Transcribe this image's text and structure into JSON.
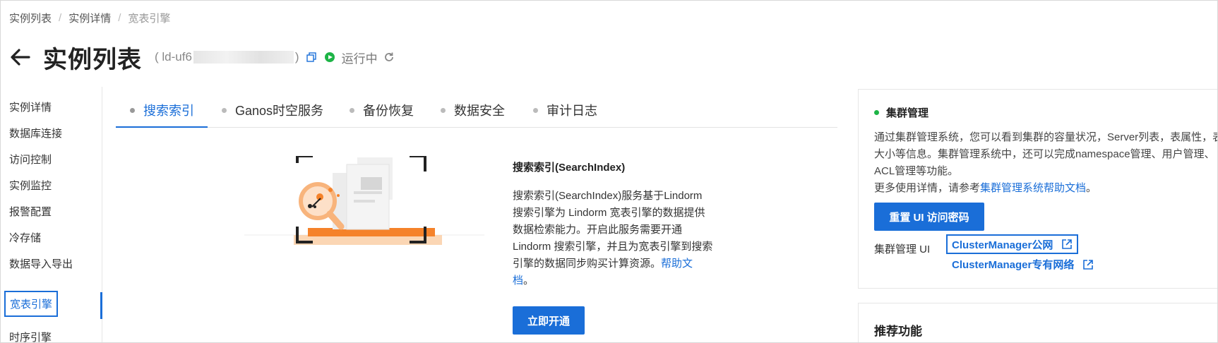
{
  "breadcrumb": {
    "items": [
      "实例列表",
      "实例详情",
      "宽表引擎"
    ],
    "separator": "/"
  },
  "header": {
    "title": "实例列表",
    "instance_id_prefix": "( ld-uf6",
    "instance_id_suffix": ")",
    "status": "运行中",
    "status_color": "#1db446"
  },
  "sidebar": {
    "items": [
      {
        "label": "实例详情"
      },
      {
        "label": "数据库连接"
      },
      {
        "label": "访问控制"
      },
      {
        "label": "实例监控"
      },
      {
        "label": "报警配置"
      },
      {
        "label": "冷存储"
      },
      {
        "label": "数据导入导出"
      },
      {
        "label": "宽表引擎"
      },
      {
        "label": "时序引擎"
      }
    ],
    "active_label": "宽表引擎"
  },
  "tabs": {
    "items": [
      {
        "label": "搜索索引"
      },
      {
        "label": "Ganos时空服务"
      },
      {
        "label": "备份恢复"
      },
      {
        "label": "数据安全"
      },
      {
        "label": "审计日志"
      }
    ],
    "active_label": "搜索索引"
  },
  "feature": {
    "title": "搜索索引(SearchIndex)",
    "description": "搜索索引(SearchIndex)服务基于Lindorm 搜索引擎为 Lindorm 宽表引擎的数据提供数据检索能力。开启此服务需要开通 Lindorm 搜索引擎，并且为宽表引擎到搜索引擎的数据同步购买计算资源。",
    "help_link": "帮助文档",
    "help_tail": "。",
    "button": "立即开通"
  },
  "cluster_card": {
    "title": "集群管理",
    "description": "通过集群管理系统，您可以看到集群的容量状况，Server列表，表属性，表大小等信息。集群管理系统中，还可以完成namespace管理、用户管理、ACL管理等功能。",
    "more_prefix": "更多使用详情，请参考",
    "more_link": "集群管理系统帮助文档",
    "more_suffix": "。",
    "reset_button": "重置 UI 访问密码",
    "ui_label": "集群管理 UI",
    "link_public": "ClusterManager公网",
    "link_vpc": "ClusterManager专有网络"
  },
  "recommend_card": {
    "title": "推荐功能"
  },
  "colors": {
    "accent": "#1a6ed8",
    "illustration_orange": "#f5822a"
  }
}
